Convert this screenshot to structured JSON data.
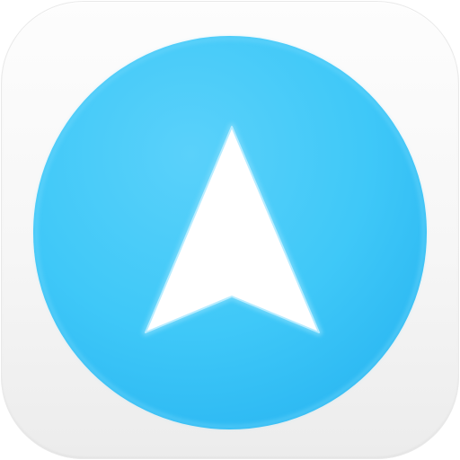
{
  "app_icon": {
    "icon": "navigation-arrow-icon",
    "colors": {
      "tile_background": "#f5f5f5",
      "circle_fill": "#3fc8f8",
      "circle_fill_dark": "#2db9f2",
      "circle_rim": "#62d4fb",
      "arrow_fill": "#ffffff"
    }
  }
}
